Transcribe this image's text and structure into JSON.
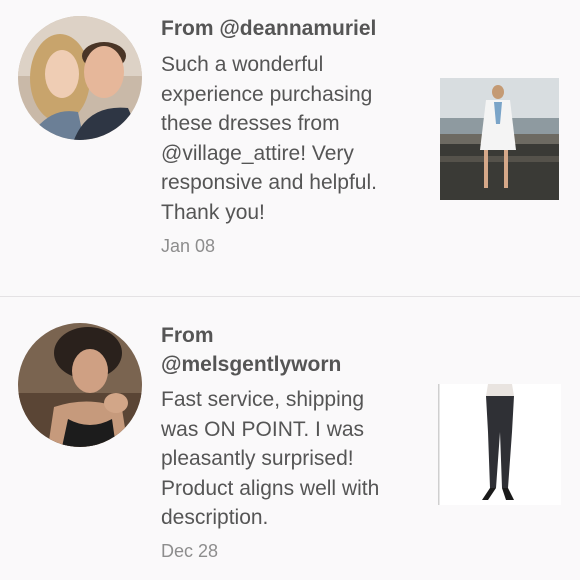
{
  "reviews": [
    {
      "from": "From @deannamuriel",
      "text": "Such a wonderful\nexperience purchasing\nthese dresses from\n@village_attire! Very\nresponsive and helpful.\nThank you!",
      "date": "Jan 08",
      "avatar_icon": "couple-photo",
      "thumbnail_icon": "white-tunic-dress-photo"
    },
    {
      "from": "From\n@melsgentlyworn",
      "text": "Fast service, shipping\nwas ON POINT. I was\npleasantly surprised!\nProduct aligns well with\ndescription.",
      "date": "Dec 28",
      "avatar_icon": "woman-selfie-photo",
      "thumbnail_icon": "dark-jeans-photo"
    }
  ]
}
